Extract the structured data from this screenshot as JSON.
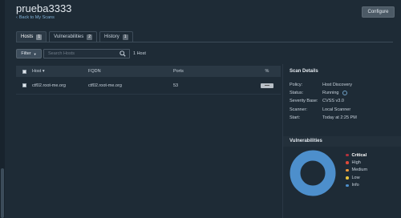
{
  "header": {
    "title": "prueba3333",
    "back_link": "Back to My Scans",
    "configure_label": "Configure"
  },
  "tabs": [
    {
      "label": "Hosts",
      "count": "1",
      "active": true
    },
    {
      "label": "Vulnerabilities",
      "count": "2",
      "active": false
    },
    {
      "label": "History",
      "count": "1",
      "active": false
    }
  ],
  "toolbar": {
    "filter_label": "Filter",
    "search_placeholder": "Search Hosts",
    "host_count": "1 Host"
  },
  "table": {
    "columns": [
      "Host ▾",
      "FQDN",
      "Ports",
      "%"
    ],
    "rows": [
      {
        "host": "ctf02.root-me.org",
        "fqdn": "ctf02.root-me.org",
        "ports": "53"
      }
    ]
  },
  "scan_details": {
    "title": "Scan Details",
    "rows": [
      {
        "key": "Policy:",
        "value": "Host Discovery"
      },
      {
        "key": "Status:",
        "value": "Running"
      },
      {
        "key": "Severity Base:",
        "value": "CVSS v3.0"
      },
      {
        "key": "Scanner:",
        "value": "Local Scanner"
      },
      {
        "key": "Start:",
        "value": "Today at 2:25 PM"
      }
    ]
  },
  "vulnerabilities": {
    "title": "Vulnerabilities",
    "legend": [
      {
        "label": "Critical",
        "color": "#b5323d"
      },
      {
        "label": "High",
        "color": "#dd4a3b"
      },
      {
        "label": "Medium",
        "color": "#ef9a3c"
      },
      {
        "label": "Low",
        "color": "#e9c43f"
      },
      {
        "label": "Info",
        "color": "#4d8fcc"
      }
    ],
    "info_share": 1.0
  }
}
